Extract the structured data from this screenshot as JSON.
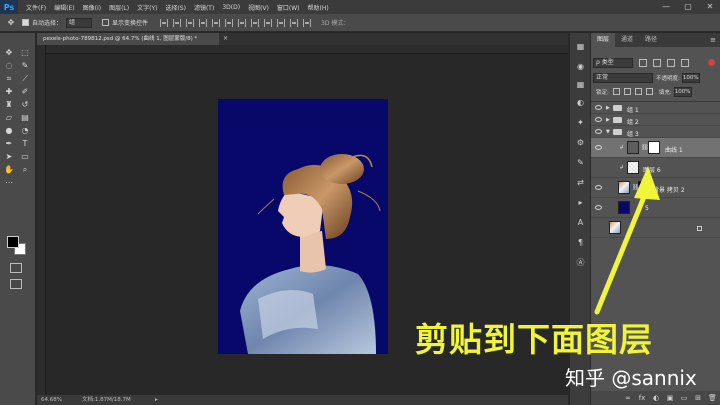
{
  "app": {
    "logo": "Ps",
    "menu": [
      "文件(F)",
      "编辑(E)",
      "图像(I)",
      "图层(L)",
      "文字(Y)",
      "选择(S)",
      "滤镜(T)",
      "3D(D)",
      "视图(V)",
      "窗口(W)",
      "帮助(H)"
    ],
    "window_controls": [
      "—",
      "▢",
      "✕"
    ]
  },
  "options": {
    "auto_select_label": "自动选择：",
    "auto_select_value": "组",
    "show_transform_label": "显示变换控件",
    "mode_3d_label": "3D 模式："
  },
  "document": {
    "tab_title": "pexels-photo-789812.psd @ 64.7% (曲线 1, 图层蒙版/8) *",
    "tab_close": "×"
  },
  "status": {
    "zoom": "64.68%",
    "doc": "文档:1.87M/18.7M",
    "arrow": "▸"
  },
  "layers_panel": {
    "tabs": [
      "图层",
      "通道",
      "路径"
    ],
    "menu_icon": "≡",
    "filter_kind": "ρ 类型",
    "blend_mode": "正常",
    "opacity_label": "不透明度:",
    "opacity_value": "100%",
    "lock_label": "锁定:",
    "fill_label": "填充:",
    "fill_value": "100%",
    "layers": [
      {
        "name": "组 1",
        "type": "group"
      },
      {
        "name": "组 2",
        "type": "group"
      },
      {
        "name": "组 3",
        "type": "group"
      },
      {
        "name": "曲线 1",
        "type": "adjustment",
        "selected": true
      },
      {
        "name": "图层 6",
        "type": "layer"
      },
      {
        "name": "背景 拷贝 2",
        "type": "layer"
      },
      {
        "name": "5",
        "type": "layer"
      },
      {
        "name": "",
        "type": "layer"
      }
    ],
    "bottom_icons": [
      "∞",
      "fx",
      "◐",
      "▣",
      "▭",
      "⊞",
      "🗑"
    ]
  },
  "overlay": {
    "caption": "剪贴到下面图层",
    "watermark": "知乎 @sannix",
    "accent_color": "#f0f53a"
  }
}
